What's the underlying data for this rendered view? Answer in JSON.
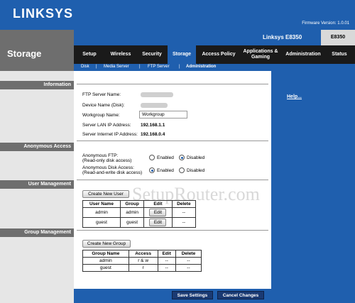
{
  "brand": "LINKSYS",
  "firmware": "Firmware Version: 1.0.01",
  "model": "Linksys E8350",
  "model_short": "E8350",
  "page_title": "Storage",
  "tabs": [
    "Setup",
    "Wireless",
    "Security",
    "Storage",
    "Access Policy",
    "Applications & Gaming",
    "Administration",
    "Status"
  ],
  "subtabs": [
    "Disk",
    "Media Server",
    "FTP Server",
    "Administration"
  ],
  "sections": [
    "Information",
    "Anonymous Access",
    "User Management",
    "Group Management"
  ],
  "info": {
    "ftp_server_name_label": "FTP Server Name:",
    "device_name_label": "Device Name (Disk):",
    "workgroup_label": "Workgroup Name:",
    "workgroup_value": "Workgroup",
    "lan_ip_label": "Server LAN IP Address:",
    "lan_ip": "192.168.1.1",
    "internet_ip_label": "Server Internet IP Address:",
    "internet_ip": "192.168.0.4"
  },
  "anon": {
    "ftp_label": "Anonymous FTP:",
    "ftp_sub": "(Read-only disk access)",
    "disk_label": "Anonymous Disk Access:",
    "disk_sub": "(Read-and-write disk access)",
    "enabled": "Enabled",
    "disabled": "Disabled"
  },
  "users": {
    "create_btn": "Create New User",
    "headers": [
      "User Name",
      "Group",
      "Edit",
      "Delete"
    ],
    "rows": [
      [
        "admin",
        "admin",
        "Edit",
        "--"
      ],
      [
        "guest",
        "guest",
        "Edit",
        "--"
      ]
    ]
  },
  "groups": {
    "create_btn": "Create New Group",
    "headers": [
      "Group Name",
      "Access",
      "Edit",
      "Delete"
    ],
    "rows": [
      [
        "admin",
        "r & w",
        "--",
        "--"
      ],
      [
        "guest",
        "r",
        "--",
        "--"
      ]
    ]
  },
  "help": "Help...",
  "save": "Save Settings",
  "cancel": "Cancel Changes",
  "watermark": "SetupRouter.com",
  "colors": {
    "brand_blue": "#1f5fae",
    "nav_dark": "#1a1a1a",
    "section_gray": "#6e6e6e"
  }
}
